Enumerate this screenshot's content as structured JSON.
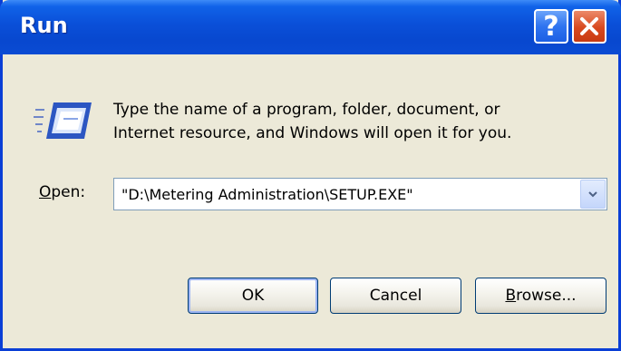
{
  "window": {
    "title": "Run"
  },
  "titlebar_buttons": {
    "help_glyph": "?",
    "help_icon": "help-question-icon",
    "close_icon": "close-x-icon"
  },
  "icon": {
    "name": "run-program-icon"
  },
  "prompt": {
    "line1": "Type the name of a program, folder, document, or",
    "line2": "Internet resource, and Windows will open it for you."
  },
  "open_field": {
    "label_accel": "O",
    "label_rest": "pen:",
    "value": "\"D:\\Metering Administration\\SETUP.EXE\"",
    "dropdown_icon": "chevron-down-icon"
  },
  "buttons": {
    "ok": "OK",
    "cancel": "Cancel",
    "browse_accel": "B",
    "browse_rest": "rowse..."
  },
  "colors": {
    "titlebar": "#0a4fd8",
    "window_bg": "#ece9d8",
    "close_button": "#d8491f",
    "help_button": "#2f74f0"
  }
}
